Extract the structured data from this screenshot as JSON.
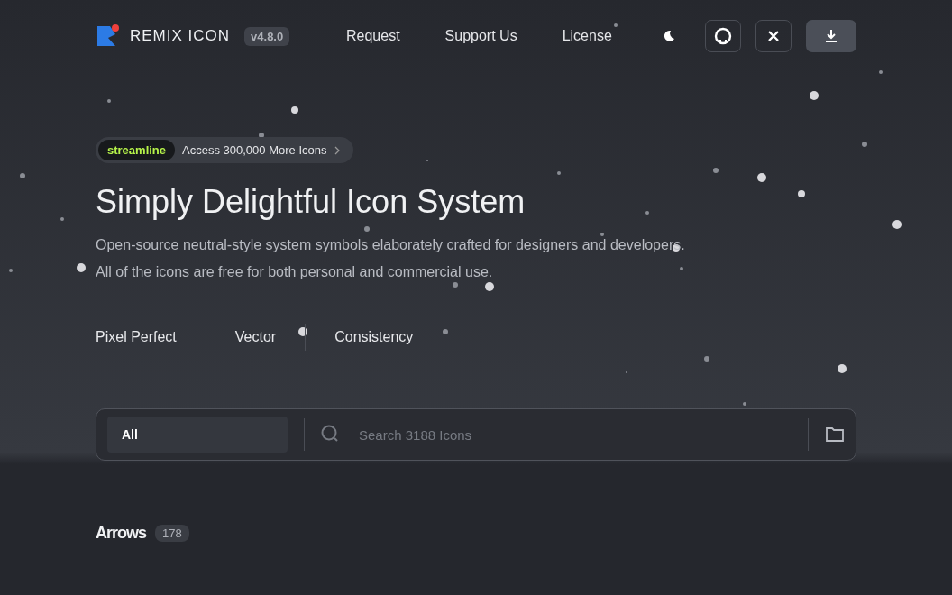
{
  "nav": {
    "brand": "REMIX ICON",
    "version": "v4.8.0",
    "links": [
      "Request",
      "Support Us",
      "License"
    ]
  },
  "promo": {
    "badge": "streamline",
    "text": "Access 300,000 More Icons"
  },
  "hero": {
    "title": "Simply Delightful Icon System",
    "lines": [
      "Open-source neutral-style system symbols elaborately crafted for designers and developers.",
      "All of the icons are free for both personal and commercial use."
    ]
  },
  "features": [
    "Pixel Perfect",
    "Vector",
    "Consistency"
  ],
  "search": {
    "category": "All",
    "placeholder": "Search 3188 Icons"
  },
  "section": {
    "title": "Arrows",
    "count": "178"
  }
}
